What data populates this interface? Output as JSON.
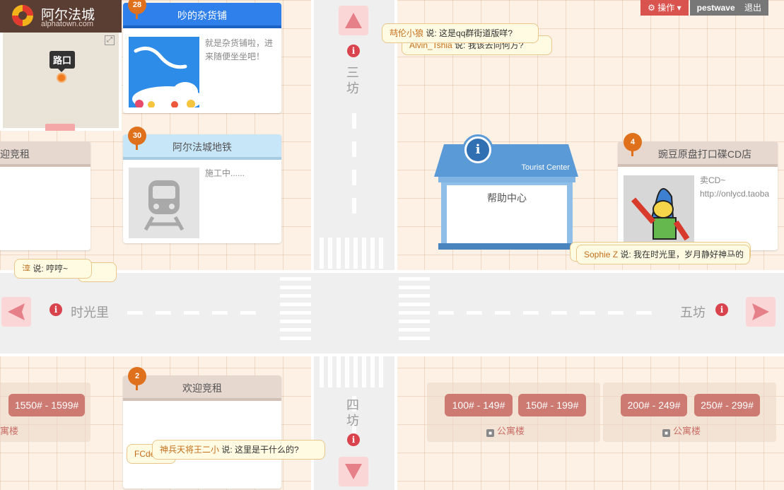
{
  "logo": {
    "title": "阿尔法城",
    "subtitle": "alphatown.com"
  },
  "minimap": {
    "tooltip": "路口"
  },
  "topbar": {
    "operate": "操作",
    "username": "pestwave",
    "logout": "退出"
  },
  "streets": {
    "north": "三坊",
    "south": "四坊",
    "west": "时光里",
    "east": "五坊"
  },
  "cards": {
    "grocery": {
      "count": "28",
      "title": "吵的杂货铺",
      "desc": "就是杂货铺啦，进来随便坐坐吧！"
    },
    "metro": {
      "count": "30",
      "title": "阿尔法城地铁",
      "desc": "施工中......"
    },
    "cd_shop": {
      "count": "4",
      "title": "豌豆原盘打口碟CD店",
      "desc1": "卖CD~",
      "desc2": "http://onlycd.taoba"
    },
    "rent_left": {
      "title": "迎竞租"
    },
    "rent_bottom": {
      "count": "2",
      "title": "欢迎竞租"
    }
  },
  "help_center": {
    "sign": "Tourist Center",
    "label": "帮助中心"
  },
  "bubbles": [
    {
      "who": "喆伦小狼",
      "text": "说: 这是qq群街道版咩?"
    },
    {
      "who": "Alvin_Tshia",
      "text": "说: 我该去向何方?"
    },
    {
      "who": "淳",
      "text": "说: 哼哼~"
    },
    {
      "who": "Sophie Z",
      "text": "说: 我在时光里，岁月静好神马的"
    },
    {
      "who": "神兵天将王二小",
      "text": "说: 这里是干什么的?"
    },
    {
      "who": "FCde",
      "text": ""
    }
  ],
  "rooms": {
    "left": "1550# - 1599#",
    "r1": "100# - 149#",
    "r2": "150# - 199#",
    "r3": "200# - 249#",
    "r4": "250# - 299#",
    "apt": "公寓楼",
    "apt_left": "寓楼"
  },
  "colors": {
    "accent": "#d9534f",
    "pin": "#e0711c",
    "road": "#efefef",
    "ground": "#fcf1e4"
  }
}
